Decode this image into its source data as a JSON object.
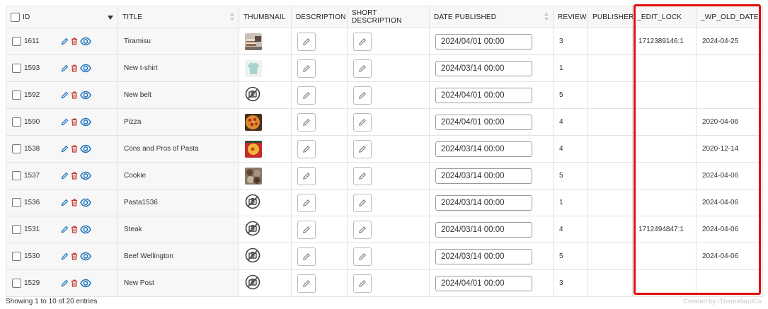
{
  "columns": {
    "id": "ID",
    "title": "TITLE",
    "thumbnail": "THUMBNAIL",
    "description": "DESCRIPTION",
    "short_description": "SHORT DESCRIPTION",
    "date_published": "DATE PUBLISHED",
    "review": "REVIEW",
    "publisher": "PUBLISHER",
    "edit_lock": "_EDIT_LOCK",
    "wp_old_date": "_WP_OLD_DATE"
  },
  "rows": [
    {
      "id": "1611",
      "title": "Tiramisu",
      "thumb": "tiramisu-image",
      "date": "2024/04/01 00:00",
      "review": "3",
      "publisher": "",
      "edit_lock": "1712389146:1",
      "old_date": "2024-04-25"
    },
    {
      "id": "1593",
      "title": "New t-shirt",
      "thumb": "tshirt-image",
      "date": "2024/03/14 00:00",
      "review": "1",
      "publisher": "",
      "edit_lock": "",
      "old_date": ""
    },
    {
      "id": "1592",
      "title": "New belt",
      "thumb": "no-image",
      "date": "2024/04/01 00:00",
      "review": "5",
      "publisher": "",
      "edit_lock": "",
      "old_date": ""
    },
    {
      "id": "1590",
      "title": "Pizza",
      "thumb": "pizza-image",
      "date": "2024/04/01 00:00",
      "review": "4",
      "publisher": "",
      "edit_lock": "",
      "old_date": "2020-04-06"
    },
    {
      "id": "1538",
      "title": "Cons and Pros of Pasta",
      "thumb": "pasta-image",
      "date": "2024/03/14 00:00",
      "review": "4",
      "publisher": "",
      "edit_lock": "",
      "old_date": "2020-12-14"
    },
    {
      "id": "1537",
      "title": "Cookie",
      "thumb": "cookie-image",
      "date": "2024/03/14 00:00",
      "review": "5",
      "publisher": "",
      "edit_lock": "",
      "old_date": "2024-04-06"
    },
    {
      "id": "1536",
      "title": "Pasta1536",
      "thumb": "no-image",
      "date": "2024/03/14 00:00",
      "review": "1",
      "publisher": "",
      "edit_lock": "",
      "old_date": "2024-04-06"
    },
    {
      "id": "1531",
      "title": "Steak",
      "thumb": "no-image",
      "date": "2024/03/14 00:00",
      "review": "4",
      "publisher": "",
      "edit_lock": "1712494847:1",
      "old_date": "2024-04-06"
    },
    {
      "id": "1530",
      "title": "Beef Wellington",
      "thumb": "no-image",
      "date": "2024/03/14 00:00",
      "review": "5",
      "publisher": "",
      "edit_lock": "",
      "old_date": "2024-04-06"
    },
    {
      "id": "1529",
      "title": "New Post",
      "thumb": "no-image",
      "date": "2024/04/01 00:00",
      "review": "3",
      "publisher": "",
      "edit_lock": "",
      "old_date": ""
    }
  ],
  "footer": {
    "entries_text": "Showing 1 to 10 of 20 entries",
    "credit_text": "Created by iThemelandCo"
  },
  "colors": {
    "highlight": "#e10f0f",
    "action_blue": "#1e73be",
    "delete_red": "#c0392b"
  },
  "icons": {
    "edit": "pencil-icon",
    "delete": "trash-icon",
    "view": "eye-icon",
    "no_image": "no-camera-icon",
    "description_edit": "pencil-icon"
  }
}
